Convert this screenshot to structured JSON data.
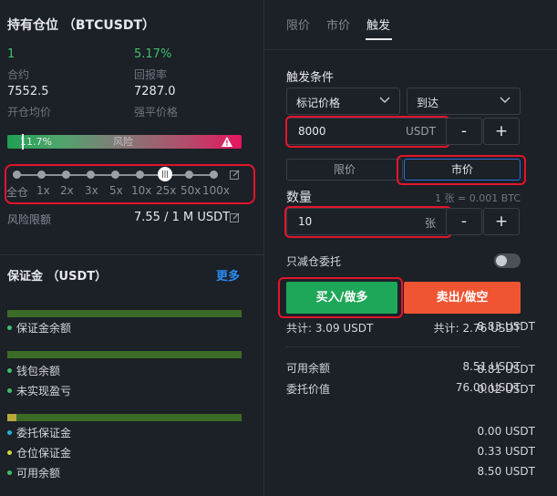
{
  "position": {
    "title": "持有仓位 （BTCUSDT）",
    "contracts_value": "1",
    "contracts_label": "合约",
    "roe_value": "5.17%",
    "roe_label": "回报率",
    "entry_value": "7552.5",
    "entry_label": "开仓均价",
    "liq_value": "7287.0",
    "liq_label": "强平价格",
    "risk_percent": "11.7%",
    "risk_label": "风险",
    "risk_fraction": 0.117
  },
  "leverage": {
    "options": [
      "全仓",
      "1x",
      "2x",
      "3x",
      "5x",
      "10x",
      "25x",
      "50x",
      "100x"
    ],
    "selected": "25x",
    "risk_limit_label": "风险限额",
    "risk_limit_value": "7.55 / 1 M USDT"
  },
  "margin": {
    "title": "保证金 （USDT）",
    "more": "更多",
    "rows": [
      {
        "label": "保证金余额",
        "value": "8.83 USDT",
        "dot": "#3fbf6b"
      },
      {
        "label": "钱包余额",
        "value": "8.81 USDT",
        "dot": "#3fbf6b"
      },
      {
        "label": "未实现盈亏",
        "value": "0.02 USDT",
        "dot": "#3fbf6b"
      },
      {
        "label": "委托保证金",
        "value": "0.00 USDT",
        "dot": "#1fb5d6"
      },
      {
        "label": "仓位保证金",
        "value": "0.33 USDT",
        "dot": "#d6d23a"
      },
      {
        "label": "可用余额",
        "value": "8.50 USDT",
        "dot": "#3fbf6b"
      }
    ]
  },
  "order": {
    "tabs": [
      "限价",
      "市价",
      "触发"
    ],
    "active_tab": "触发",
    "trigger_label": "触发条件",
    "trigger_type": "标记价格",
    "trigger_direction": "到达",
    "trigger_price": "8000",
    "trigger_unit": "USDT",
    "minus": "-",
    "plus": "+",
    "exec_types": [
      "限价",
      "市价"
    ],
    "exec_active": "市价",
    "qty_label": "数量",
    "qty_hint": "1 张 = 0.001 BTC",
    "qty_value": "10",
    "qty_unit": "张",
    "reduce_only": "只减仓委托",
    "buy_label": "买入/做多",
    "sell_label": "卖出/做空",
    "buy_total": "共计: 3.09 USDT",
    "sell_total": "共计: 2.76 USDT",
    "available_label": "可用余额",
    "available_value": "8.51 USDT",
    "order_value_label": "委托价值",
    "order_value_value": "76.00 USDT"
  },
  "colors": {
    "buy": "#1fa759",
    "sell": "#f05533",
    "accent": "#2a8cf4",
    "highlight": "#e3152b"
  }
}
